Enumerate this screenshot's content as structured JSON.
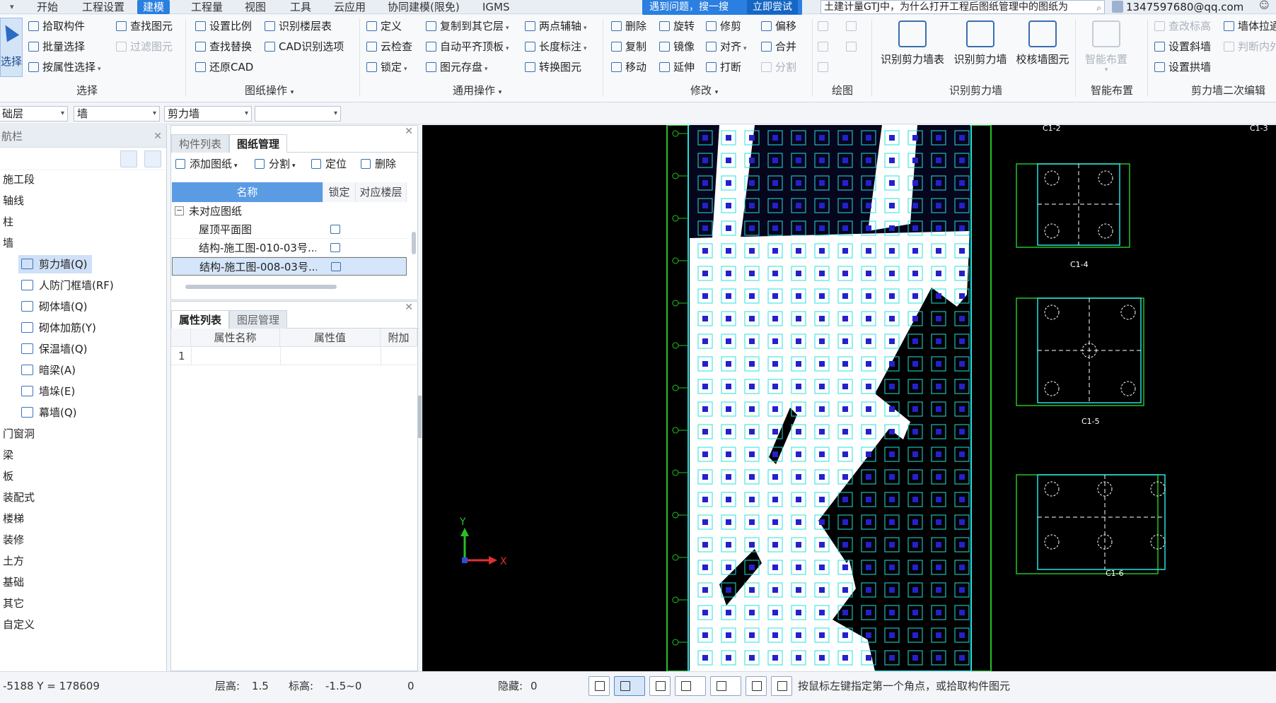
{
  "menubar": {
    "items": [
      "开始",
      "工程设置",
      "建模",
      "工程量",
      "视图",
      "工具",
      "云应用",
      "协同建模(限免)",
      "IGMS"
    ],
    "active_index": 2,
    "help_text": "遇到问题，搜一搜",
    "help_try": "立即尝试",
    "search_value": "土建计量GTJ中，为什么打开工程后图纸管理中的图纸为",
    "user_email": "1347597680@qq.com"
  },
  "ribbon": {
    "select_label": "选择",
    "group_select": {
      "label": "选择",
      "buttons": [
        "拾取构件",
        "批量选择",
        "按属性选择",
        "查找图元",
        "过滤图元"
      ]
    },
    "group_drawing": {
      "label": "图纸操作",
      "buttons": [
        "设置比例",
        "查找替换",
        "还原CAD",
        "识别楼层表",
        "CAD识别选项"
      ]
    },
    "group_general": {
      "label": "通用操作",
      "buttons": [
        "定义",
        "云检查",
        "锁定",
        "复制到其它层",
        "自动平齐顶板",
        "图元存盘",
        "两点辅轴",
        "长度标注",
        "转换图元"
      ]
    },
    "group_modify": {
      "label": "修改",
      "buttons": [
        "删除",
        "复制",
        "移动",
        "旋转",
        "镜像",
        "延伸",
        "修剪",
        "对齐",
        "打断",
        "偏移",
        "合并",
        "分割"
      ]
    },
    "group_draw": {
      "label": "绘图"
    },
    "group_identify": {
      "label": "识别剪力墙",
      "buttons": [
        "识别剪力墙表",
        "识别剪力墙",
        "校核墙图元"
      ]
    },
    "group_smart": {
      "label": "智能布置",
      "buttons": [
        "智能布置"
      ]
    },
    "group_secondary": {
      "label": "剪力墙二次编辑",
      "buttons": [
        "查改标高",
        "设置斜墙",
        "设置拱墙",
        "墙体拉通",
        "判断内外"
      ]
    }
  },
  "filters": {
    "floor": "础层",
    "category": "墙",
    "type": "剪力墙",
    "element": ""
  },
  "nav": {
    "title": "航栏",
    "top_items": [
      "施工段",
      "轴线",
      "柱",
      "墙"
    ],
    "wall_items": [
      "剪力墙(Q)",
      "人防门框墙(RF)",
      "砌体墙(Q)",
      "砌体加筋(Y)",
      "保温墙(Q)",
      "暗梁(A)",
      "墙垛(E)",
      "幕墙(Q)"
    ],
    "bottom_items": [
      "门窗洞",
      "梁",
      "板",
      "装配式",
      "楼梯",
      "装修",
      "土方",
      "基础",
      "其它",
      "自定义"
    ]
  },
  "drawing_panel": {
    "tabs": [
      "构件列表",
      "图纸管理"
    ],
    "toolbar": [
      "添加图纸",
      "分割",
      "定位",
      "删除"
    ],
    "columns": [
      "名称",
      "锁定",
      "对应楼层"
    ],
    "group_label": "未对应图纸",
    "rows": [
      "屋顶平面图",
      "结构-施工图-010-03号...",
      "结构-施工图-008-03号..."
    ]
  },
  "props_panel": {
    "tabs": [
      "属性列表",
      "图层管理"
    ],
    "columns": [
      "属性名称",
      "属性值",
      "附加"
    ],
    "row_num": "1"
  },
  "canvas": {
    "axis_x": "X",
    "axis_y": "Y",
    "labels": [
      "C1-2",
      "C1-3",
      "C1-4",
      "C1-5",
      "C1-6"
    ]
  },
  "status": {
    "coords": "-5188 Y = 178609",
    "floor_height_label": "层高:",
    "floor_height_value": "1.5",
    "elevation_label": "标高:",
    "elevation_value": "-1.5~0",
    "zero_value": "0",
    "hidden_label": "隐藏:",
    "hidden_value": "0",
    "hint": "按鼠标左键指定第一个角点，或拾取构件图元"
  },
  "colors": {
    "accent": "#2a7fe0",
    "canvas_bg": "#000000",
    "cad_cyan": "#26e0e0",
    "cad_green": "#26c026",
    "cad_blue": "#2222cc"
  }
}
